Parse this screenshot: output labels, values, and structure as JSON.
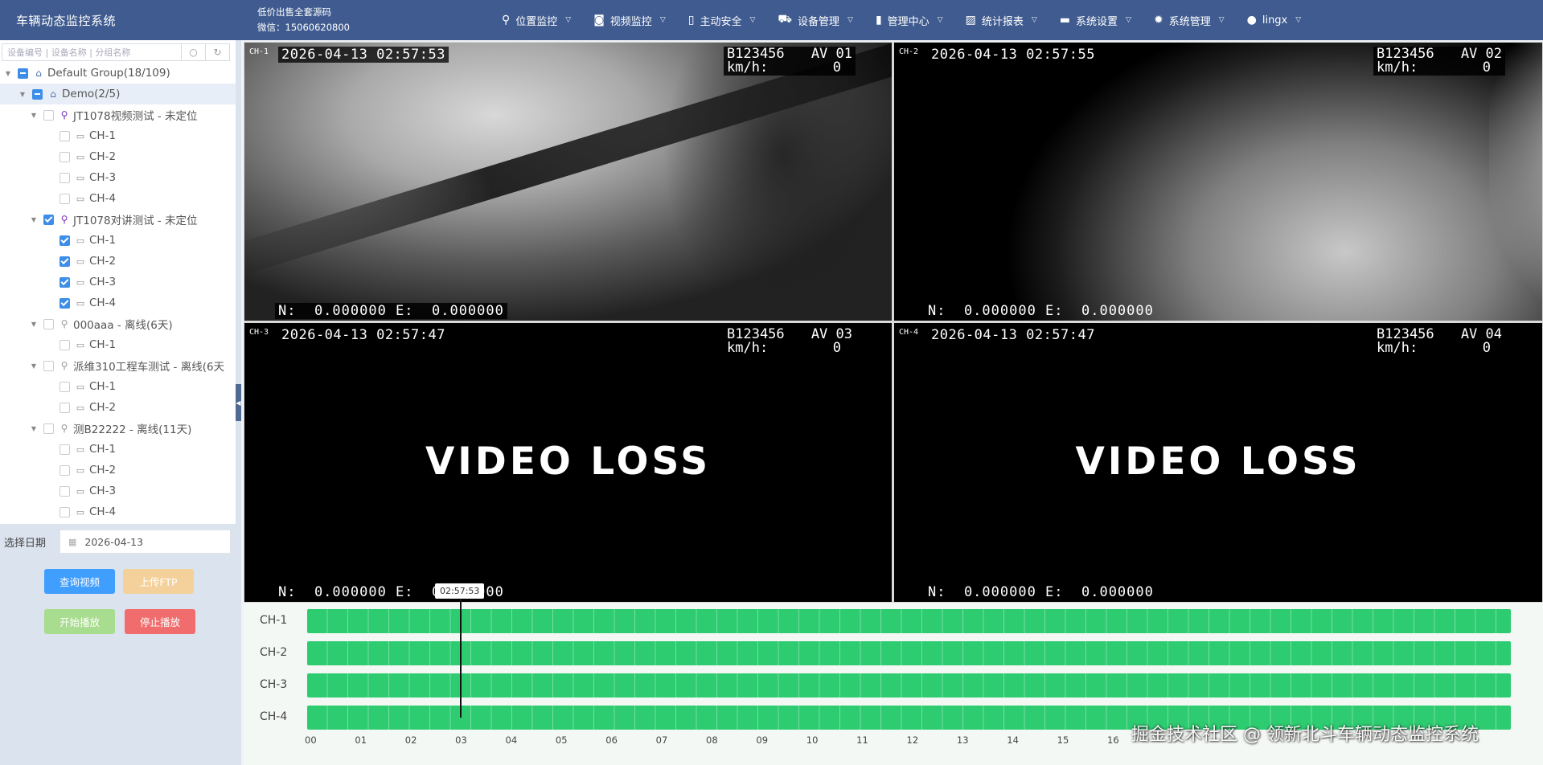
{
  "app": {
    "title": "车辆动态监控系统",
    "promo_line1": "低价出售全套源码",
    "promo_line2": "微信：15060620800"
  },
  "menu": [
    {
      "label": "位置监控",
      "icon": "location-icon"
    },
    {
      "label": "视频监控",
      "icon": "camera-icon"
    },
    {
      "label": "主动安全",
      "icon": "bookmark-icon"
    },
    {
      "label": "设备管理",
      "icon": "truck-icon"
    },
    {
      "label": "管理中心",
      "icon": "book-icon"
    },
    {
      "label": "统计报表",
      "icon": "chart-icon"
    },
    {
      "label": "系统设置",
      "icon": "monitor-icon"
    },
    {
      "label": "系统管理",
      "icon": "gear-icon"
    },
    {
      "label": "lingx",
      "icon": "user-icon"
    }
  ],
  "sidebar": {
    "search_placeholder": "设备编号 | 设备名称 | 分组名称",
    "tree": [
      {
        "label": "Default Group(18/109)",
        "level": 0,
        "type": "group",
        "check": "partial",
        "expanded": true
      },
      {
        "label": "Demo(2/5)",
        "level": 1,
        "type": "group",
        "check": "partial",
        "expanded": true,
        "selected": true
      },
      {
        "label": "JT1078视频测试 - 未定位",
        "level": 2,
        "type": "device-online",
        "check": "none",
        "expanded": true
      },
      {
        "label": "CH-1",
        "level": 3,
        "type": "channel",
        "check": "none"
      },
      {
        "label": "CH-2",
        "level": 3,
        "type": "channel",
        "check": "none"
      },
      {
        "label": "CH-3",
        "level": 3,
        "type": "channel",
        "check": "none"
      },
      {
        "label": "CH-4",
        "level": 3,
        "type": "channel",
        "check": "none"
      },
      {
        "label": "JT1078对讲测试 - 未定位",
        "level": 2,
        "type": "device-online",
        "check": "checked",
        "expanded": true
      },
      {
        "label": "CH-1",
        "level": 3,
        "type": "channel",
        "check": "checked"
      },
      {
        "label": "CH-2",
        "level": 3,
        "type": "channel",
        "check": "checked"
      },
      {
        "label": "CH-3",
        "level": 3,
        "type": "channel",
        "check": "checked"
      },
      {
        "label": "CH-4",
        "level": 3,
        "type": "channel",
        "check": "checked"
      },
      {
        "label": "000aaa - 离线(6天)",
        "level": 2,
        "type": "device-offline",
        "check": "none",
        "expanded": true
      },
      {
        "label": "CH-1",
        "level": 3,
        "type": "channel",
        "check": "none"
      },
      {
        "label": "派维310工程车测试 - 离线(6天",
        "level": 2,
        "type": "device-offline",
        "check": "none",
        "expanded": true
      },
      {
        "label": "CH-1",
        "level": 3,
        "type": "channel",
        "check": "none"
      },
      {
        "label": "CH-2",
        "level": 3,
        "type": "channel",
        "check": "none"
      },
      {
        "label": "测B22222 - 离线(11天)",
        "level": 2,
        "type": "device-offline",
        "check": "none",
        "expanded": true
      },
      {
        "label": "CH-1",
        "level": 3,
        "type": "channel",
        "check": "none"
      },
      {
        "label": "CH-2",
        "level": 3,
        "type": "channel",
        "check": "none"
      },
      {
        "label": "CH-3",
        "level": 3,
        "type": "channel",
        "check": "none"
      },
      {
        "label": "CH-4",
        "level": 3,
        "type": "channel",
        "check": "none"
      }
    ],
    "date_label": "选择日期",
    "date_value": "2026-04-13",
    "buttons": {
      "query": "查询视频",
      "upload": "上传FTP",
      "start": "开始播放",
      "stop": "停止播放"
    }
  },
  "videos": [
    {
      "ch": "CH-1",
      "time": "2026-04-13 02:57:53",
      "plate": "B123456",
      "av": "AV 01",
      "speed_label": "km/h:",
      "speed": "0",
      "gps": "N:  0.000000 E:  0.000000",
      "loss": false
    },
    {
      "ch": "CH-2",
      "time": "2026-04-13 02:57:55",
      "plate": "B123456",
      "av": "AV 02",
      "speed_label": "km/h:",
      "speed": "0",
      "gps": "N:  0.000000 E:  0.000000",
      "loss": false
    },
    {
      "ch": "CH-3",
      "time": "2026-04-13 02:57:47",
      "plate": "B123456",
      "av": "AV 03",
      "speed_label": "km/h:",
      "speed": "0",
      "gps": "N:  0.000000 E:  0.000000",
      "loss": true,
      "loss_text": "VIDEO LOSS"
    },
    {
      "ch": "CH-4",
      "time": "2026-04-13 02:57:47",
      "plate": "B123456",
      "av": "AV 04",
      "speed_label": "km/h:",
      "speed": "0",
      "gps": "N:  0.000000 E:  0.000000",
      "loss": true,
      "loss_text": "VIDEO LOSS"
    }
  ],
  "timeline": {
    "channels": [
      "CH-1",
      "CH-2",
      "CH-3",
      "CH-4"
    ],
    "hours": [
      "00",
      "01",
      "02",
      "03",
      "04",
      "05",
      "06",
      "07",
      "08",
      "09",
      "10",
      "11",
      "12",
      "13",
      "14",
      "15",
      "16"
    ],
    "cursor_time": "02:57:53",
    "bar_color": "#2ecc71"
  },
  "watermark": "掘金技术社区 @ 领新北斗车辆动态监控系统",
  "colors": {
    "header": "#3f5b8f",
    "primary": "#409eff",
    "danger": "#f16d6d",
    "warning_light": "#f4d19a",
    "success_light": "#a8dc8e"
  }
}
